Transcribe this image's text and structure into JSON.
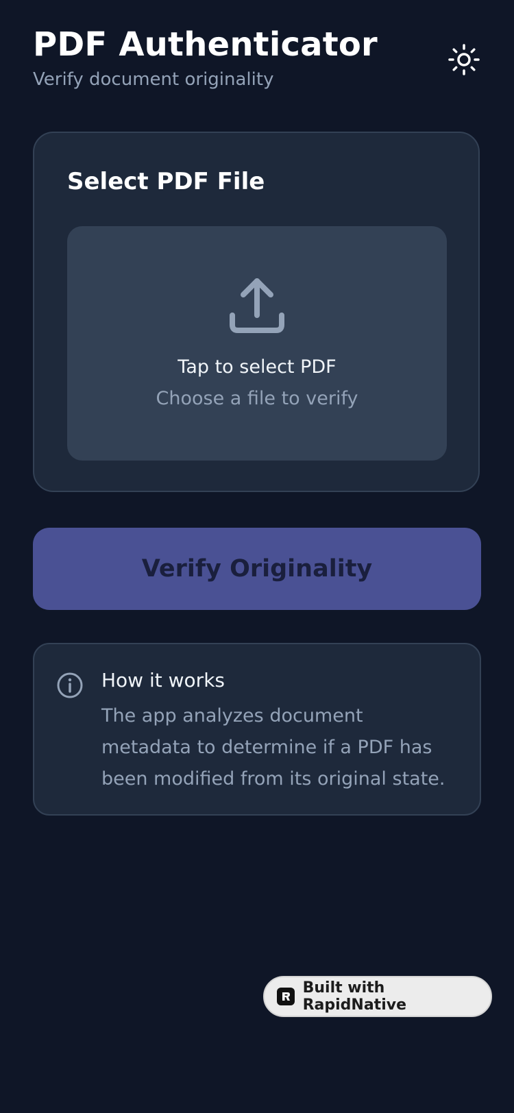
{
  "header": {
    "title": "PDF Authenticator",
    "subtitle": "Verify document originality"
  },
  "icons": {
    "theme": "sun-icon",
    "upload": "upload-icon",
    "info": "info-icon",
    "badge": "rapidnative-logo-icon"
  },
  "select_card": {
    "title": "Select PDF File",
    "dropzone_primary": "Tap to select PDF",
    "dropzone_secondary": "Choose a file to verify"
  },
  "verify_button": {
    "label": "Verify Originality"
  },
  "info": {
    "title": "How it works",
    "text": "The app analyzes document metadata to determine if a PDF has been modified from its original state."
  },
  "badge": {
    "label": "Built with RapidNative"
  },
  "colors": {
    "background": "#0f1627",
    "card": "#1e293b",
    "dropzone": "#334155",
    "accent_button": "#4a5194",
    "muted_text": "#94a3b8"
  }
}
